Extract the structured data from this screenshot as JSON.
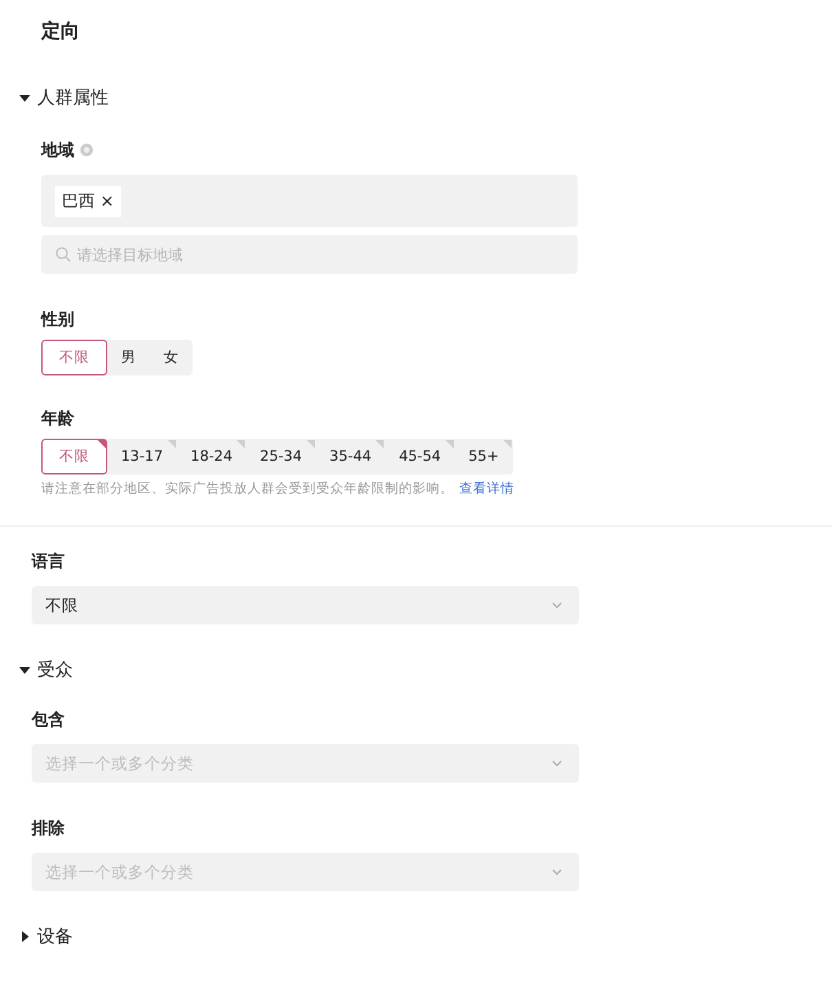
{
  "title": "定向",
  "demographics": {
    "label": "人群属性",
    "expanded": true,
    "location": {
      "label": "地域",
      "tags": [
        {
          "label": "巴西",
          "remove": "×"
        }
      ],
      "placeholder": "请选择目标地域"
    },
    "gender": {
      "label": "性别",
      "options": [
        {
          "label": "不限",
          "selected": true
        },
        {
          "label": "男",
          "selected": false
        },
        {
          "label": "女",
          "selected": false
        }
      ]
    },
    "age": {
      "label": "年龄",
      "options": [
        {
          "label": "不限",
          "selected": true
        },
        {
          "label": "13-17",
          "selected": false
        },
        {
          "label": "18-24",
          "selected": false
        },
        {
          "label": "25-34",
          "selected": false
        },
        {
          "label": "35-44",
          "selected": false
        },
        {
          "label": "45-54",
          "selected": false
        },
        {
          "label": "55+",
          "selected": false
        }
      ],
      "note": "请注意在部分地区、实际广告投放人群会受到受众年龄限制的影响。",
      "link": "查看详情"
    }
  },
  "language": {
    "label": "语言",
    "value": "不限"
  },
  "audience": {
    "label": "受众",
    "expanded": true,
    "fields": [
      {
        "label": "包含",
        "placeholder": "选择一个或多个分类"
      },
      {
        "label": "排除",
        "placeholder": "选择一个或多个分类"
      }
    ]
  },
  "devices": {
    "label": "设备",
    "expanded": false
  }
}
